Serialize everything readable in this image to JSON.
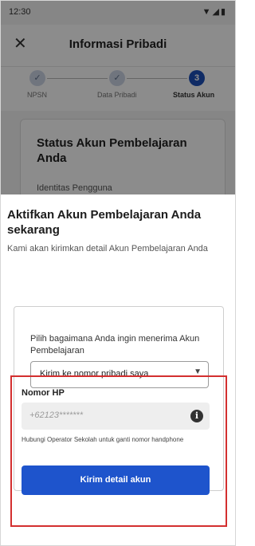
{
  "status_bar": {
    "time": "12:30",
    "icons": "▼◢▮"
  },
  "header": {
    "close_icon": "✕",
    "title": "Informasi Pribadi"
  },
  "stepper": {
    "steps": [
      {
        "label": "NPSN",
        "state": "done",
        "marker": "✓"
      },
      {
        "label": "Data Pribadi",
        "state": "done",
        "marker": "✓"
      },
      {
        "label": "Status Akun",
        "state": "active",
        "marker": "3"
      }
    ]
  },
  "background_card": {
    "title": "Status Akun Pembelajaran Anda",
    "subtitle": "Identitas Pengguna"
  },
  "sheet": {
    "title": "Aktifkan Akun Pembelajaran Anda sekarang",
    "description": "Kami akan kirimkan detail Akun Pembelajaran Anda",
    "method": {
      "label": "Pilih bagaimana Anda ingin menerima Akun Pembelajaran",
      "selected": "Kirim ke nomor pribadi saya",
      "arrow_icon": "▼"
    },
    "phone": {
      "label": "Nomor HP",
      "value": "+62123*******",
      "info_icon": "i",
      "helper": "Hubungi Operator Sekolah untuk ganti nomor handphone"
    },
    "submit_label": "Kirim detail akun"
  },
  "colors": {
    "primary": "#1e54cc",
    "step_active": "#1d4fb8",
    "highlight": "#d32f2f"
  }
}
